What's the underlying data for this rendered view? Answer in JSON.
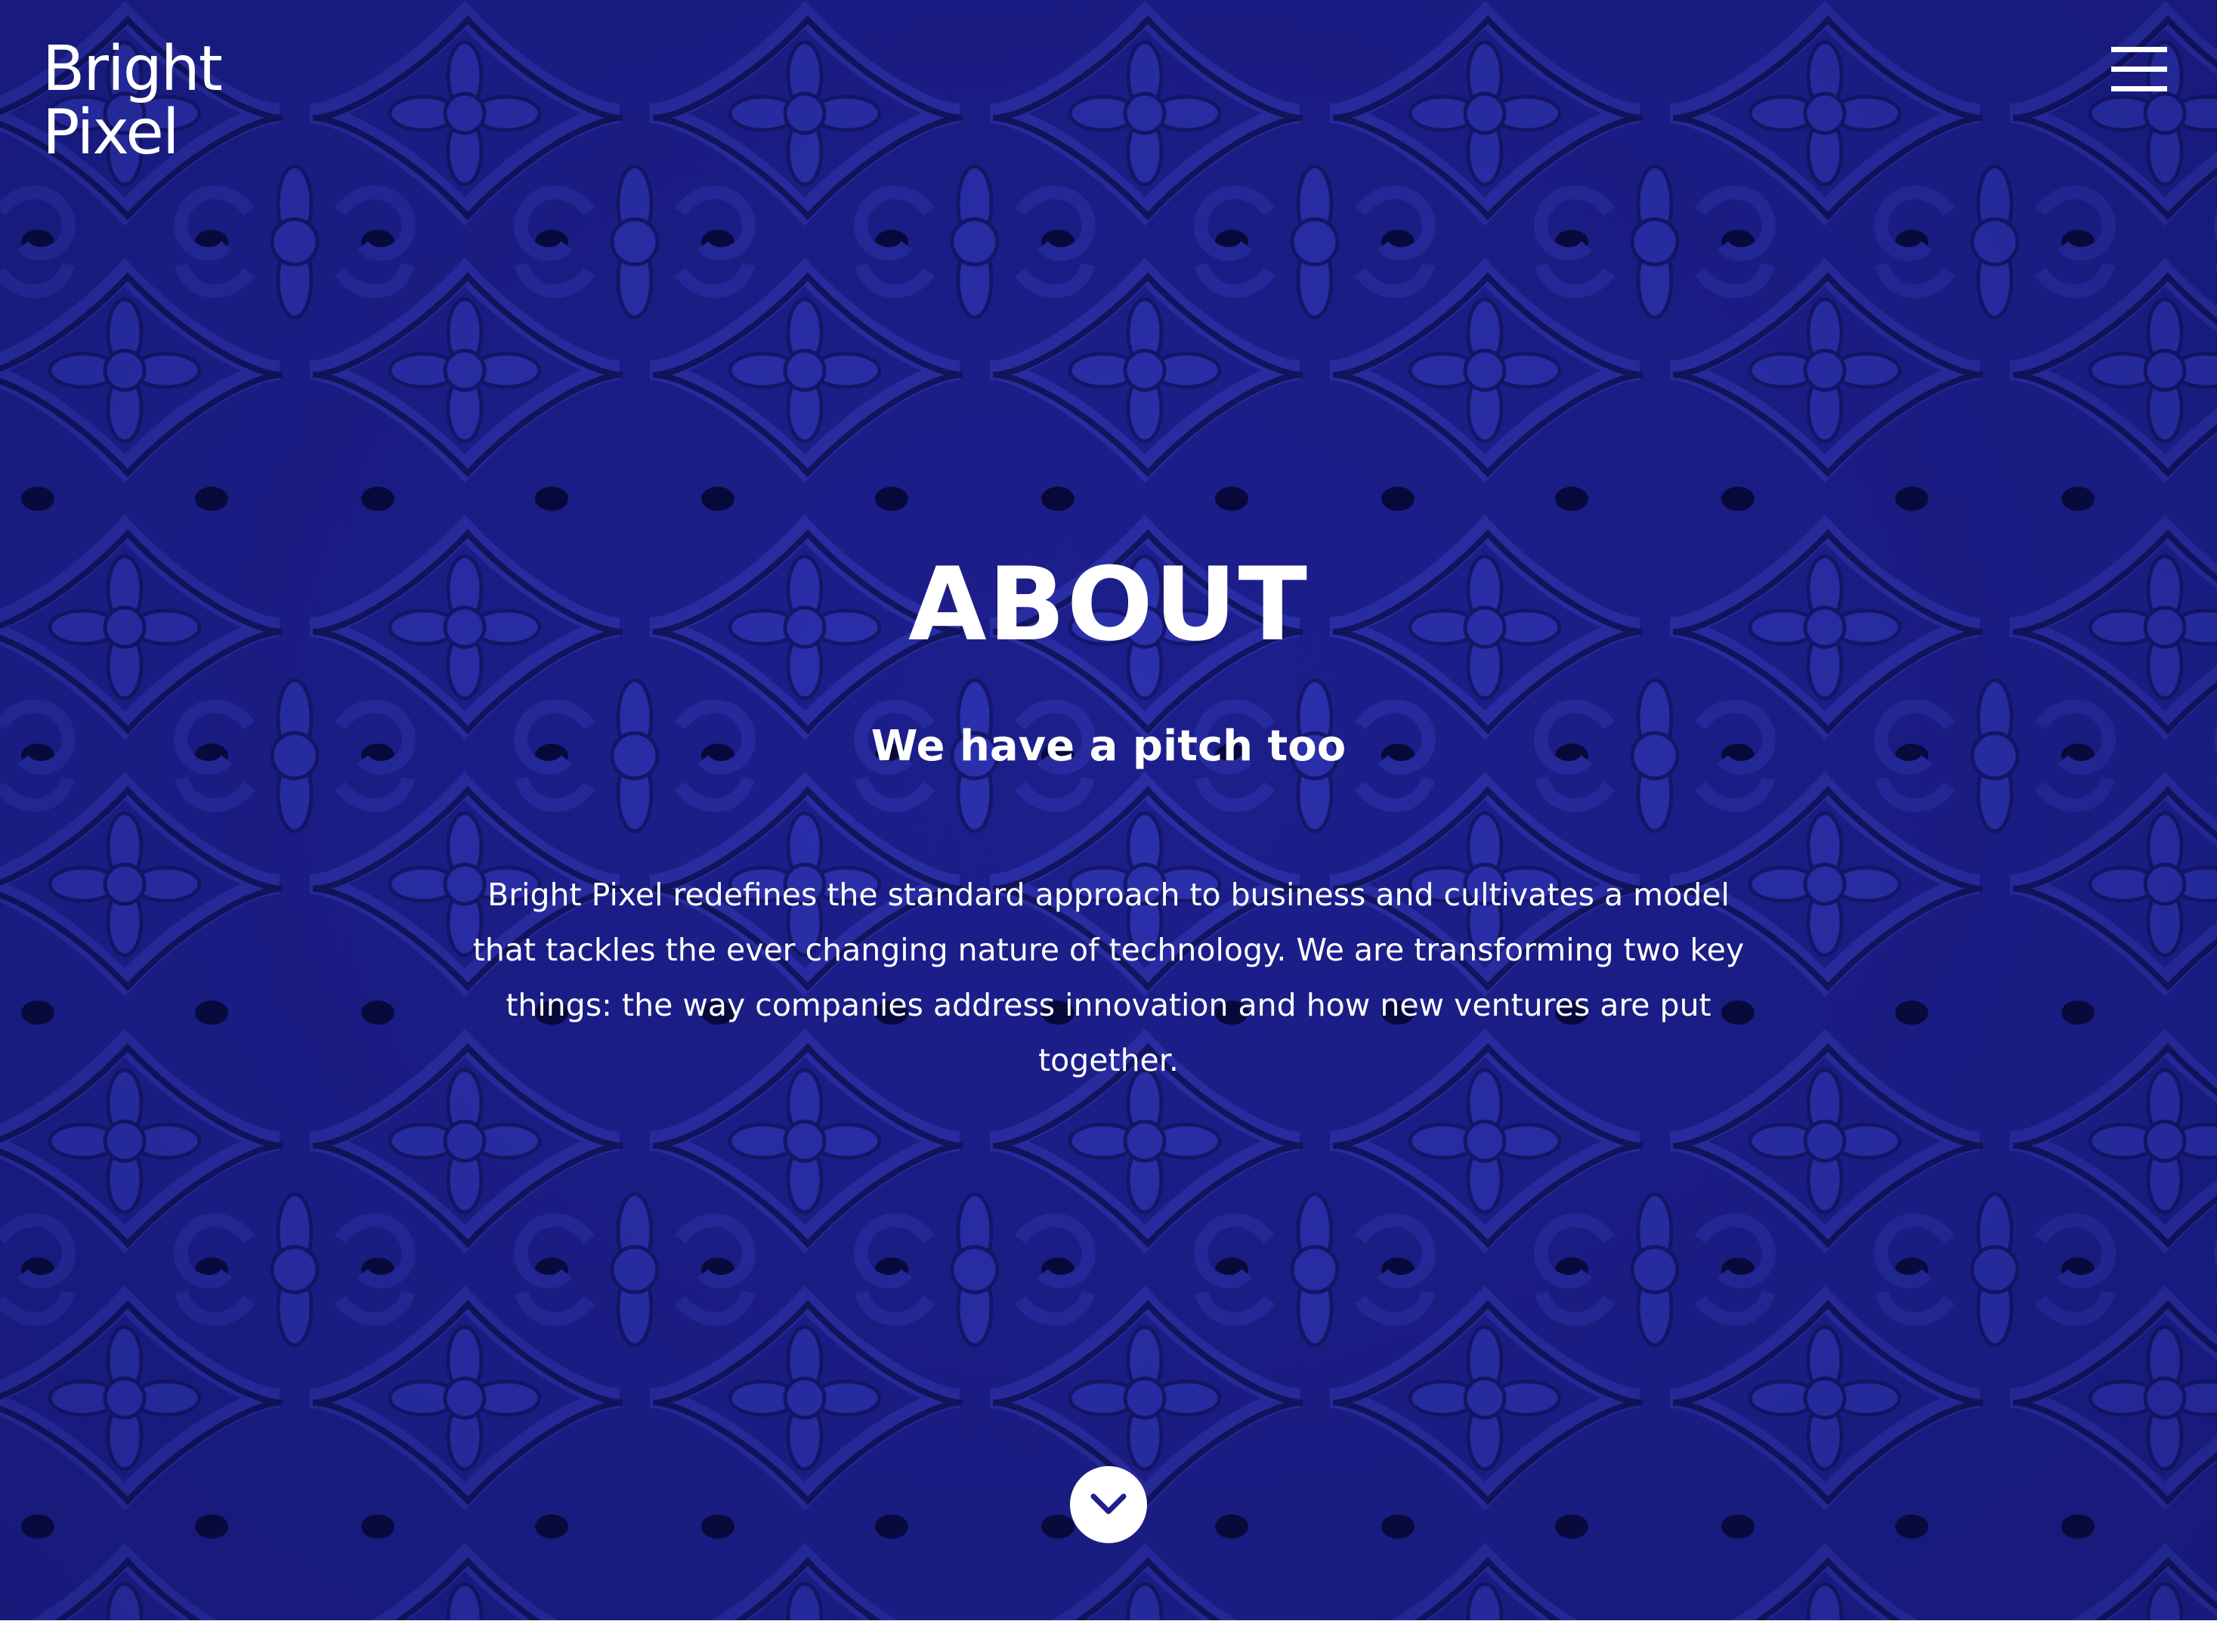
{
  "brand": {
    "logo_line1": "Bright",
    "logo_line2": "Pixel"
  },
  "header": {
    "menu_icon": "hamburger-menu-icon"
  },
  "hero": {
    "title": "ABOUT",
    "subtitle": "We have a pitch too",
    "body": "Bright Pixel redefines the standard approach to business and cultivates a model that tackles the ever changing nature of technology. We are transforming two key things: the way companies address innovation and how new ventures are put together.",
    "scroll_icon": "chevron-down-icon"
  },
  "colors": {
    "background_blue": "#1c1f8c",
    "text": "#ffffff",
    "button_bg": "#ffffff",
    "chevron": "#1c1f8c"
  }
}
